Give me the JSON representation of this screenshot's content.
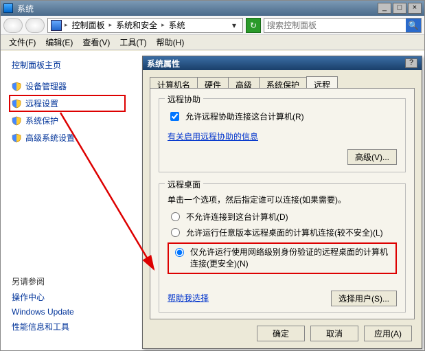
{
  "window": {
    "title": "系统",
    "min_tip": "_",
    "max_tip": "□",
    "close_tip": "×"
  },
  "breadcrumb": {
    "segments": [
      "控制面板",
      "系统和安全",
      "系统"
    ],
    "dropdown_glyph": "▾"
  },
  "search": {
    "placeholder": "搜索控制面板",
    "icon": "🔍"
  },
  "menubar": {
    "items": [
      "文件(F)",
      "编辑(E)",
      "查看(V)",
      "工具(T)",
      "帮助(H)"
    ]
  },
  "sidebar": {
    "header": "控制面板主页",
    "items": [
      {
        "label": "设备管理器"
      },
      {
        "label": "远程设置",
        "highlighted": true
      },
      {
        "label": "系统保护"
      },
      {
        "label": "高级系统设置"
      }
    ]
  },
  "see_also": {
    "header": "另请参阅",
    "links": [
      "操作中心",
      "Windows Update",
      "性能信息和工具"
    ]
  },
  "dialog": {
    "title": "系统属性",
    "help_glyph": "?",
    "tabs": [
      "计算机名",
      "硬件",
      "高级",
      "系统保护",
      "远程"
    ],
    "active_tab_index": 4,
    "remote_assistance": {
      "legend": "远程协助",
      "checkbox_label": "允许远程协助连接这台计算机(R)",
      "checkbox_checked": true,
      "link": "有关启用远程协助的信息",
      "advanced_btn": "高级(V)..."
    },
    "remote_desktop": {
      "legend": "远程桌面",
      "instruction": "单击一个选项，然后指定谁可以连接(如果需要)。",
      "options": [
        "不允许连接到这台计算机(D)",
        "允许运行任意版本远程桌面的计算机连接(较不安全)(L)",
        "仅允许运行使用网络级别身份验证的远程桌面的计算机连接(更安全)(N)"
      ],
      "selected_index": 2,
      "help_link": "帮助我选择",
      "select_users_btn": "选择用户(S)..."
    },
    "buttons": {
      "ok": "确定",
      "cancel": "取消",
      "apply": "应用(A)"
    }
  }
}
